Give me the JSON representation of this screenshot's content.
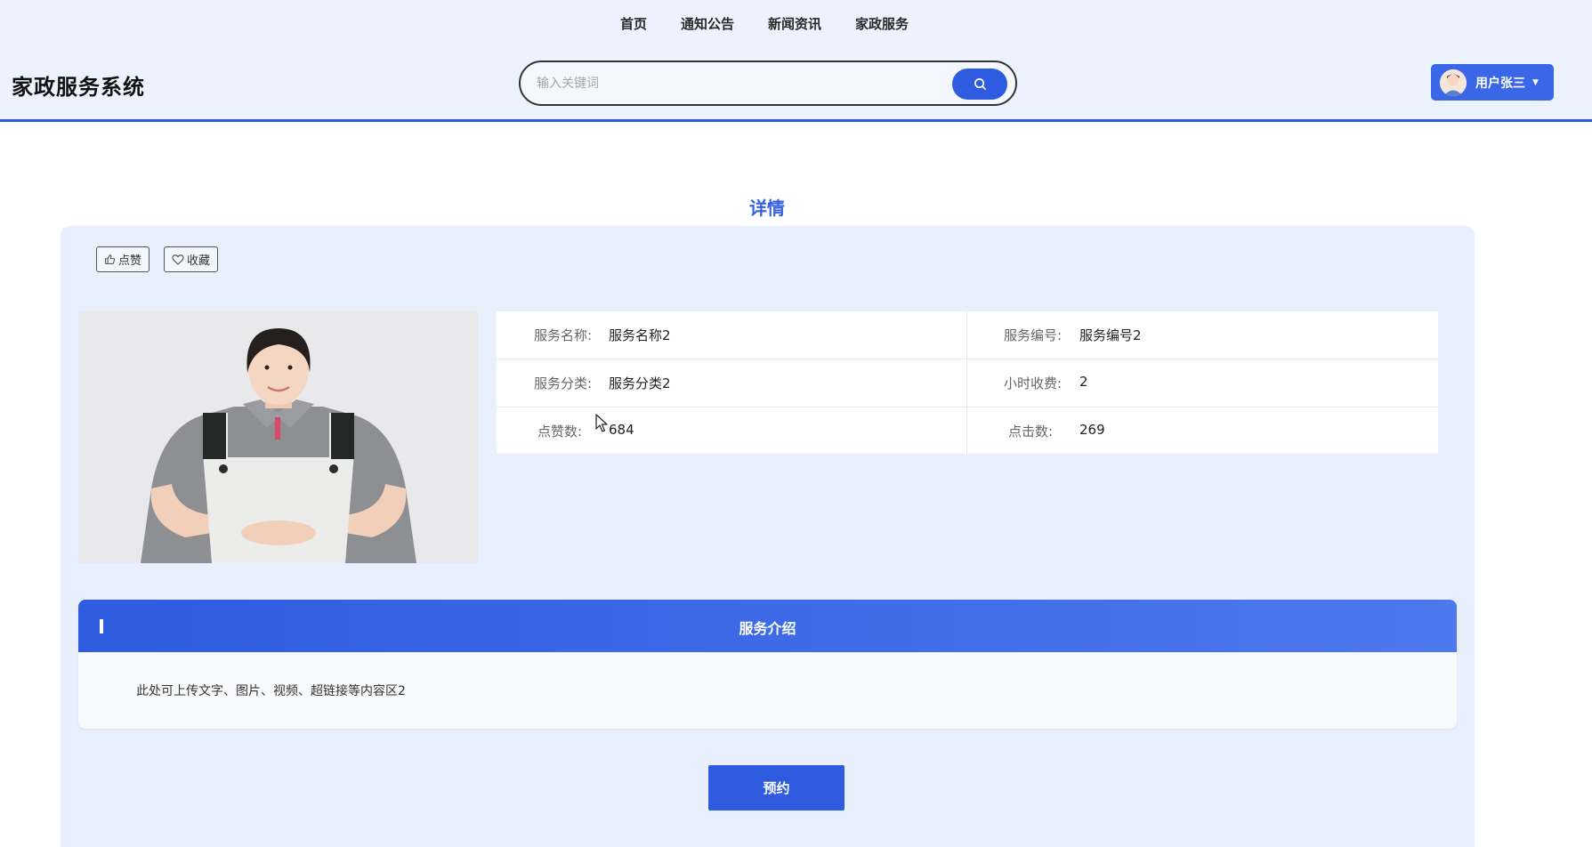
{
  "nav": {
    "items": [
      "首页",
      "通知公告",
      "新闻资讯",
      "家政服务"
    ]
  },
  "header": {
    "site_title": "家政服务系统",
    "search_placeholder": "输入关键词",
    "user_name": "用户张三",
    "accent_color": "#2f5be0"
  },
  "detail": {
    "page_title": "详情",
    "like_label": "点赞",
    "favorite_label": "收藏",
    "info": {
      "service_name_label": "服务名称:",
      "service_name": "服务名称2",
      "service_code_label": "服务编号:",
      "service_code": "服务编号2",
      "category_label": "服务分类:",
      "category": "服务分类2",
      "hourly_fee_label": "小时收费:",
      "hourly_fee": "2",
      "likes_label": "点赞数:",
      "likes": "684",
      "clicks_label": "点击数:",
      "clicks": "269"
    },
    "intro_title": "服务介绍",
    "intro_body": "此处可上传文字、图片、视频、超链接等内容区2",
    "book_label": "预约"
  }
}
